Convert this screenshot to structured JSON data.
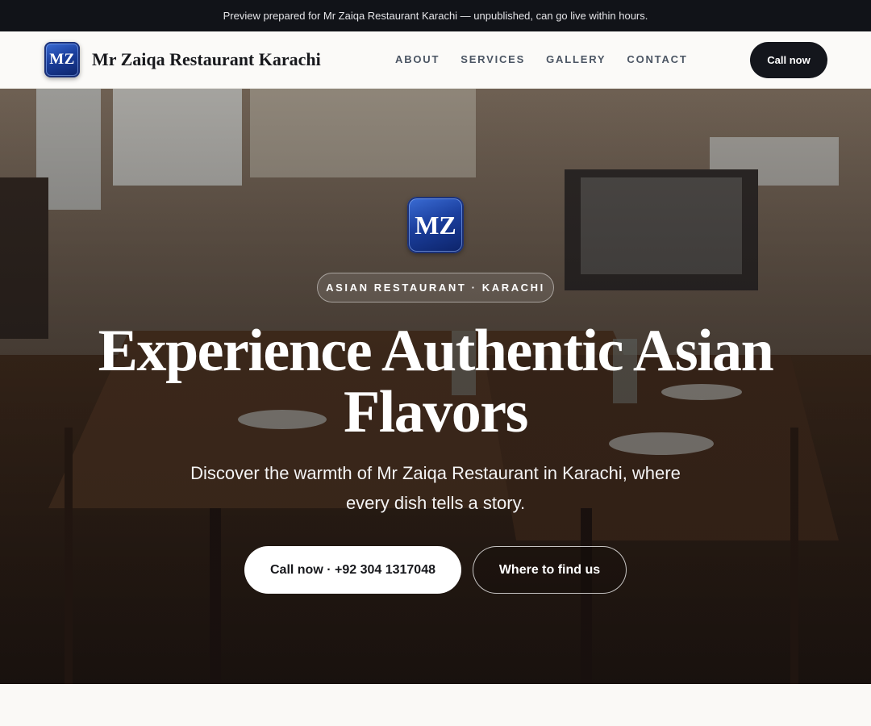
{
  "announcement": "Preview prepared for Mr Zaiqa Restaurant Karachi — unpublished, can go live within hours.",
  "brand": {
    "logo_text": "MZ",
    "name": "Mr Zaiqa Restaurant Karachi"
  },
  "nav": {
    "links": [
      "ABOUT",
      "SERVICES",
      "GALLERY",
      "CONTACT"
    ],
    "call_label": "Call now"
  },
  "hero": {
    "logo_text": "MZ",
    "tag": "ASIAN RESTAURANT · KARACHI",
    "title": "Experience Authentic Asian Flavors",
    "subtitle": "Discover the warmth of Mr Zaiqa Restaurant in Karachi, where every dish tells a story.",
    "primary_button": "Call now · +92 304 1317048",
    "secondary_button": "Where to find us"
  },
  "colors": {
    "announcement_bg": "#111318",
    "nav_bg": "#fbfaf8",
    "dark_button": "#14161c",
    "logo_blue": "#1b3f9e",
    "page_bg": "#faf9f6"
  }
}
